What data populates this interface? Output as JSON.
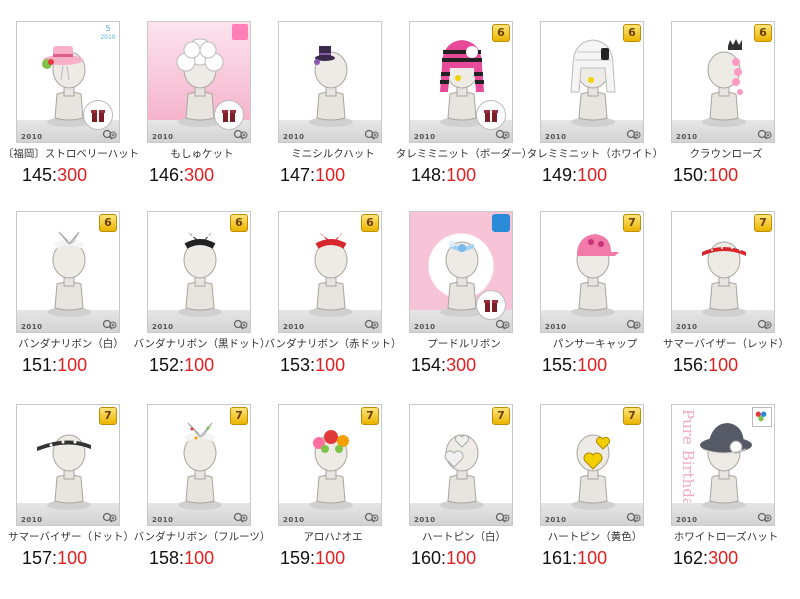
{
  "items": [
    {
      "name": "〔福岡〕ストロベリーハット",
      "num": "145",
      "price": "300",
      "bg": "plain",
      "badge": {
        "type": "five",
        "text": "5",
        "sub": "2010"
      },
      "accessory": "strawberry-hat",
      "gift": true
    },
    {
      "name": "もしゅケット",
      "num": "146",
      "price": "300",
      "bg": "pink",
      "badge": {
        "type": "pink",
        "text": ""
      },
      "accessory": "white-curly-hair",
      "gift": true
    },
    {
      "name": "ミニシルクハット",
      "num": "147",
      "price": "100",
      "bg": "plain",
      "badge": null,
      "accessory": "mini-silk-hat",
      "gift": false
    },
    {
      "name": "タレミミニット（ボーダー）",
      "num": "148",
      "price": "100",
      "bg": "plain",
      "badge": {
        "type": "gold",
        "text": "6"
      },
      "accessory": "border-knit",
      "gift": true
    },
    {
      "name": "タレミミニット（ホワイト）",
      "num": "149",
      "price": "100",
      "bg": "plain",
      "badge": {
        "type": "gold",
        "text": "6"
      },
      "accessory": "white-knit",
      "gift": false
    },
    {
      "name": "クラウンローズ",
      "num": "150",
      "price": "100",
      "bg": "plain",
      "badge": {
        "type": "gold",
        "text": "6"
      },
      "accessory": "crown-rose",
      "gift": false
    },
    {
      "name": "バンダナリボン（白）",
      "num": "151",
      "price": "100",
      "bg": "plain",
      "badge": {
        "type": "gold",
        "text": "6"
      },
      "accessory": "bandana-white",
      "gift": false
    },
    {
      "name": "バンダナリボン（黒ドット）",
      "num": "152",
      "price": "100",
      "bg": "plain",
      "badge": {
        "type": "gold",
        "text": "6"
      },
      "accessory": "bandana-black",
      "gift": false
    },
    {
      "name": "バンダナリボン（赤ドット）",
      "num": "153",
      "price": "100",
      "bg": "plain",
      "badge": {
        "type": "gold",
        "text": "6"
      },
      "accessory": "bandana-red",
      "gift": false
    },
    {
      "name": "プードルリボン",
      "num": "154",
      "price": "300",
      "bg": "pink-frame",
      "badge": {
        "type": "blue",
        "text": ""
      },
      "accessory": "poodle-ribbon",
      "gift": true
    },
    {
      "name": "パンサーキャップ",
      "num": "155",
      "price": "100",
      "bg": "plain",
      "badge": {
        "type": "gold",
        "text": "7"
      },
      "accessory": "panther-cap",
      "gift": false
    },
    {
      "name": "サマーバイザー（レッド）",
      "num": "156",
      "price": "100",
      "bg": "plain",
      "badge": {
        "type": "gold",
        "text": "7"
      },
      "accessory": "visor-red",
      "gift": false
    },
    {
      "name": "サマーバイザー（ドット）",
      "num": "157",
      "price": "100",
      "bg": "plain",
      "badge": {
        "type": "gold",
        "text": "7"
      },
      "accessory": "visor-dot",
      "gift": false
    },
    {
      "name": "バンダナリボン（フルーツ）",
      "num": "158",
      "price": "100",
      "bg": "plain",
      "badge": {
        "type": "gold",
        "text": "7"
      },
      "accessory": "bandana-fruit",
      "gift": false
    },
    {
      "name": "アロハ♪オエ",
      "num": "159",
      "price": "100",
      "bg": "plain",
      "badge": {
        "type": "gold",
        "text": "7"
      },
      "accessory": "aloha-flowers",
      "gift": false
    },
    {
      "name": "ハートピン（白）",
      "num": "160",
      "price": "100",
      "bg": "plain",
      "badge": {
        "type": "gold",
        "text": "7"
      },
      "accessory": "heart-pin-white",
      "gift": false
    },
    {
      "name": "ハートピン（黄色）",
      "num": "161",
      "price": "100",
      "bg": "plain",
      "badge": {
        "type": "gold",
        "text": "7"
      },
      "accessory": "heart-pin-yellow",
      "gift": false
    },
    {
      "name": "ホワイトローズハット",
      "num": "162",
      "price": "300",
      "bg": "watermark",
      "watermark_text": "Pure Birthday",
      "badge": {
        "type": "multi",
        "text": ""
      },
      "accessory": "white-rose-hat",
      "gift": false
    }
  ],
  "labels": {
    "year": "2010",
    "separator": ":"
  },
  "colors": {
    "price": "#e02020",
    "badge_gold": "#f2c200",
    "pink": "#f7b7cf"
  }
}
